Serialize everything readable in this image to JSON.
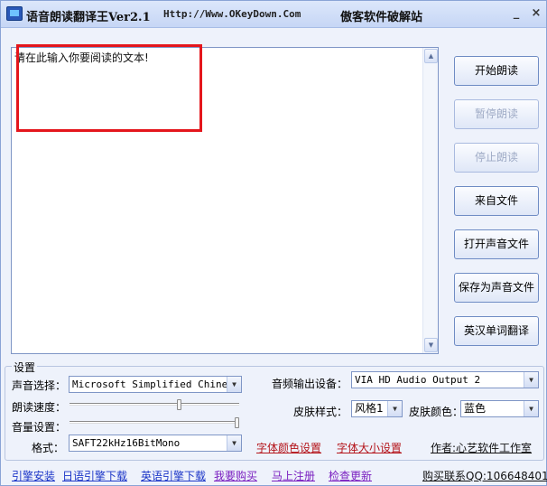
{
  "window": {
    "title": "语音朗读翻译王Ver2.1",
    "url": "Http://Www.OKeyDown.Com",
    "brand": "傲客软件破解站",
    "min_symbol": "_",
    "close_symbol": "×"
  },
  "text_area": {
    "content": "请在此输入你要阅读的文本!"
  },
  "side_buttons": {
    "start": "开始朗读",
    "pause": "暂停朗读",
    "stop": "停止朗读",
    "from_file": "来自文件",
    "open_sound": "打开声音文件",
    "save_sound": "保存为声音文件",
    "translate": "英汉单词翻译"
  },
  "settings": {
    "group_title": "设置",
    "voice_label": "声音选择：",
    "voice_value": "Microsoft Simplified Chinese",
    "speed_label": "朗读速度：",
    "speed_level": 0.65,
    "volume_label": "音量设置：",
    "volume_level": 1.0,
    "format_label": "格式：",
    "format_value": "SAFT22kHz16BitMono",
    "output_label": "音频输出设备：",
    "output_value": "VIA HD Audio Output 2",
    "skin_style_label": "皮肤样式：",
    "skin_style_value": "风格1",
    "skin_color_label": "皮肤颜色：",
    "skin_color_value": "蓝色",
    "font_color_link": "字体颜色设置",
    "font_size_link": "字体大小设置",
    "author": "作者:心艺软件工作室"
  },
  "bottom_links": {
    "engine_install": "引擎安装",
    "jp_engine": "日语引擎下载",
    "en_engine": "英语引擎下载",
    "buy": "我要购买",
    "register": "马上注册",
    "update": "检查更新",
    "contact": "购买联系QQ:1066484015"
  }
}
